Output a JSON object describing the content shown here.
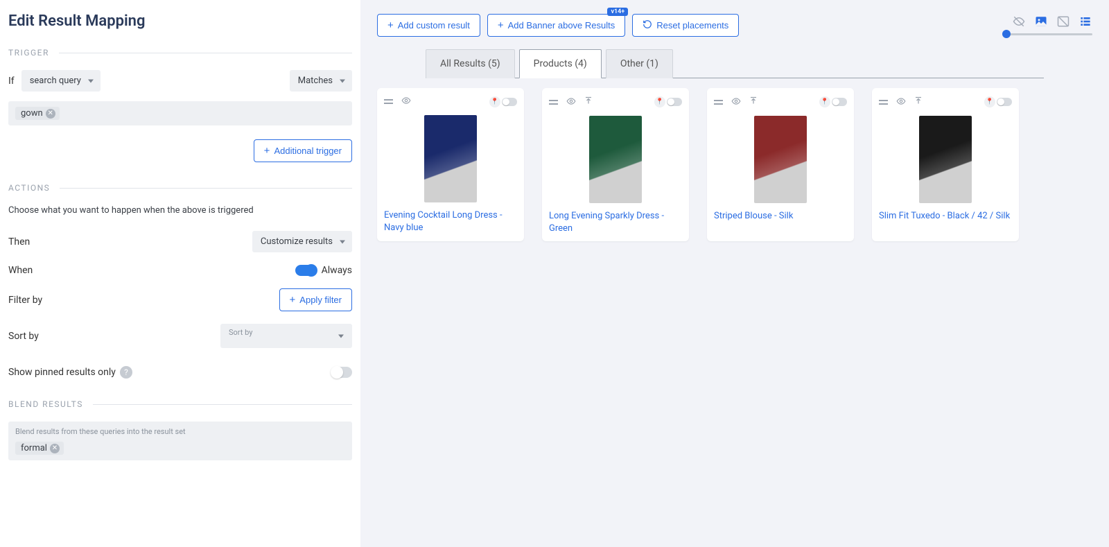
{
  "page_title": "Edit Result Mapping",
  "sections": {
    "trigger": "TRIGGER",
    "actions": "ACTIONS",
    "blend": "BLEND RESULTS"
  },
  "trigger": {
    "if_label": "If",
    "query_select": "search query",
    "match_select": "Matches",
    "tag": "gown",
    "additional_btn": "Additional trigger"
  },
  "actions": {
    "help": "Choose what you want to happen when the above is triggered",
    "then_label": "Then",
    "then_select": "Customize results",
    "when_label": "When",
    "when_value": "Always",
    "filter_label": "Filter by",
    "filter_btn": "Apply filter",
    "sort_label": "Sort by",
    "sort_placeholder": "Sort by",
    "pinned_label": "Show pinned results only"
  },
  "blend": {
    "desc": "Blend results from these queries into the result set",
    "tag": "formal"
  },
  "toolbar": {
    "add_custom": "Add custom result",
    "add_banner": "Add Banner above Results",
    "banner_badge": "v14+",
    "reset": "Reset placements"
  },
  "tabs": [
    {
      "label": "All Results (5)",
      "active": false
    },
    {
      "label": "Products (4)",
      "active": true
    },
    {
      "label": "Other (1)",
      "active": false
    }
  ],
  "products": [
    {
      "title": "Evening Cocktail Long Dress - Navy blue",
      "color": "#1a2a6b",
      "has_arrow": false
    },
    {
      "title": "Long Evening Sparkly Dress - Green",
      "color": "#1e5a3c",
      "has_arrow": true
    },
    {
      "title": "Striped Blouse - Silk",
      "color": "#8b2a2a",
      "has_arrow": true
    },
    {
      "title": "Slim Fit Tuxedo - Black / 42 / Silk",
      "color": "#1a1a1a",
      "has_arrow": true
    }
  ]
}
